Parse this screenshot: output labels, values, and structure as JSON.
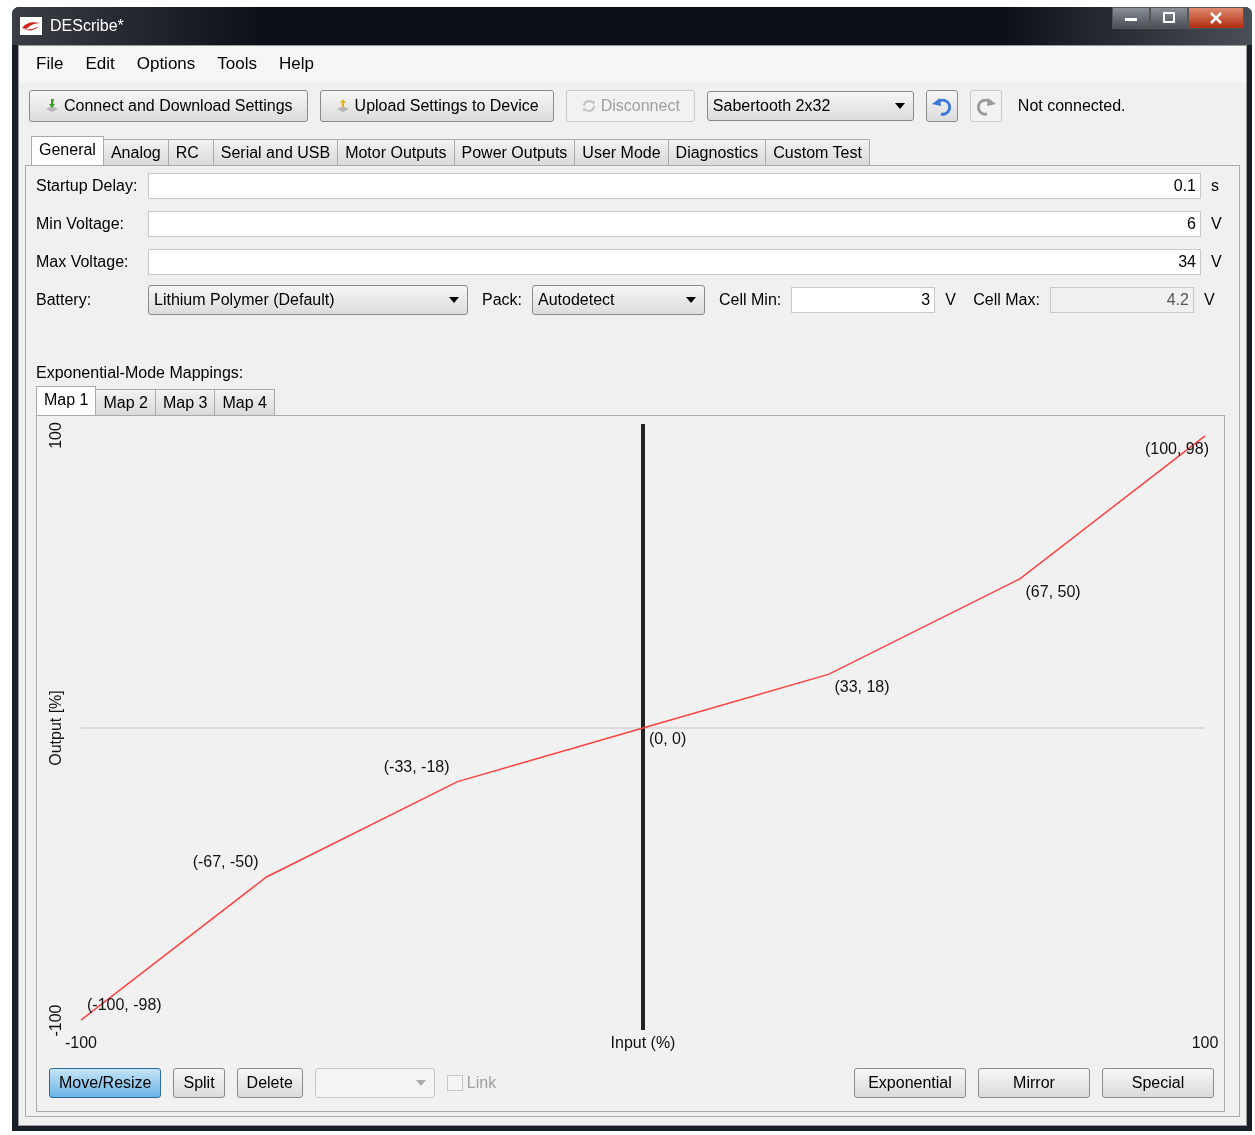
{
  "window": {
    "title": "DEScribe*"
  },
  "menu": [
    "File",
    "Edit",
    "Options",
    "Tools",
    "Help"
  ],
  "toolbar": {
    "buttons": [
      {
        "label": "Connect and Download Settings",
        "kind": "download",
        "disabled": false
      },
      {
        "label": "Upload Settings to Device",
        "kind": "upload",
        "disabled": false
      },
      {
        "label": "Disconnect",
        "kind": "disconnect",
        "disabled": true
      }
    ],
    "device": "Sabertooth 2x32",
    "undo_disabled": false,
    "redo_disabled": true,
    "status": "Not connected."
  },
  "tabs": [
    {
      "label": "General",
      "selected": true
    },
    {
      "label": "Analog",
      "selected": false
    },
    {
      "label": "RC",
      "selected": false
    },
    {
      "label": "Serial and USB",
      "selected": false
    },
    {
      "label": "Motor Outputs",
      "selected": false
    },
    {
      "label": "Power Outputs",
      "selected": false
    },
    {
      "label": "User Mode",
      "selected": false
    },
    {
      "label": "Diagnostics",
      "selected": false
    },
    {
      "label": "Custom Test",
      "selected": false
    }
  ],
  "fields": [
    {
      "label": "Startup Delay:",
      "value": "0.1",
      "unit": "s"
    },
    {
      "label": "Min Voltage:",
      "value": "6",
      "unit": "V"
    },
    {
      "label": "Max Voltage:",
      "value": "34",
      "unit": "V"
    }
  ],
  "battery": {
    "label": "Battery:",
    "value": "Lithium Polymer (Default)"
  },
  "pack": {
    "label": "Pack:",
    "value": "Autodetect"
  },
  "cells": [
    {
      "label": "Cell Min:",
      "value": "3",
      "unit": "V",
      "disabled": false
    },
    {
      "label": "Cell Max:",
      "value": "4.2",
      "unit": "V",
      "disabled": true
    }
  ],
  "mappings": {
    "title": "Exponential-Mode Mappings:",
    "tabs": [
      {
        "label": "Map 1",
        "selected": true
      },
      {
        "label": "Map 2",
        "selected": false
      },
      {
        "label": "Map 3",
        "selected": false
      },
      {
        "label": "Map 4",
        "selected": false
      }
    ],
    "chart_data": {
      "type": "line",
      "xlabel": "Input (%)",
      "ylabel": "Output [%]",
      "x": [
        -100,
        -67,
        -33,
        0,
        33,
        67,
        100
      ],
      "series": [
        {
          "color": "#ff4040",
          "values": [
            -98,
            -50,
            -18,
            0,
            18,
            50,
            98
          ]
        }
      ],
      "xlim": [
        -100,
        100
      ],
      "ylim": [
        -100,
        100
      ],
      "xticks": [
        -100,
        100
      ],
      "yticks": [
        -100,
        100
      ],
      "annotations": [
        {
          "x": -100,
          "y": -98,
          "text": "(-100, -98)"
        },
        {
          "x": -67,
          "y": -50,
          "text": "(-67, -50)"
        },
        {
          "x": -33,
          "y": -18,
          "text": "(-33, -18)"
        },
        {
          "x": 0,
          "y": 0,
          "text": "(0, 0)"
        },
        {
          "x": 33,
          "y": 18,
          "text": "(33, 18)"
        },
        {
          "x": 67,
          "y": 50,
          "text": "(67, 50)"
        },
        {
          "x": 100,
          "y": 98,
          "text": "(100, 98)"
        }
      ]
    }
  },
  "tools": {
    "buttons": [
      {
        "label": "Move/Resize",
        "selected": true
      },
      {
        "label": "Split",
        "selected": false
      },
      {
        "label": "Delete",
        "selected": false
      }
    ],
    "link": {
      "label": "Link",
      "checked": false,
      "disabled": true
    },
    "presets": [
      "Exponential",
      "Mirror",
      "Special"
    ]
  }
}
